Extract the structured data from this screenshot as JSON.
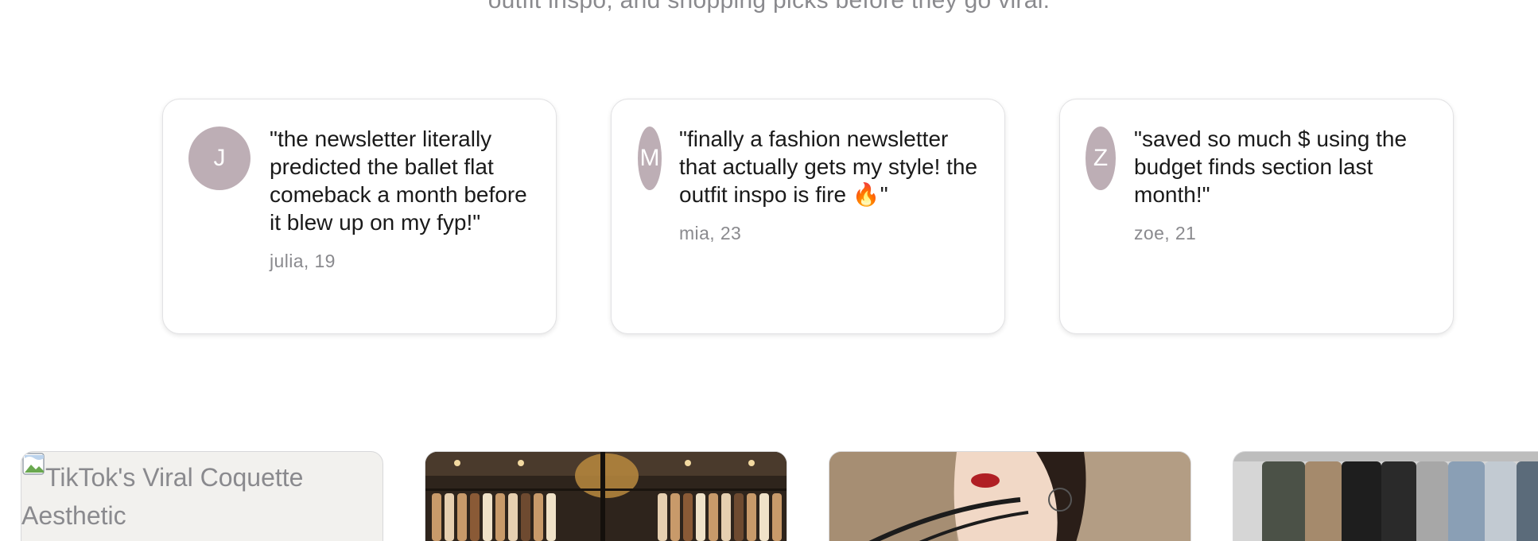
{
  "hero": {
    "subtitle": "outfit inspo, and shopping picks before they go viral."
  },
  "testimonials": [
    {
      "initial": "J",
      "quote": "\"the newsletter literally predicted the ballet flat comeback a month before it blew up on my fyp!\"",
      "author": "julia, 19"
    },
    {
      "initial": "M",
      "quote": "\"finally a fashion newsletter that actually gets my style! the outfit inspo is fire 🔥\"",
      "author": "mia, 23"
    },
    {
      "initial": "Z",
      "quote": "\"saved so much $ using the budget finds section last month!\"",
      "author": "zoe, 21"
    }
  ],
  "gallery": {
    "tile_1_alt": "TikTok's Viral Coquette Aesthetic",
    "tile_1_icon": "broken-image-icon"
  },
  "colors": {
    "avatar_bg": "#bdaeb5",
    "muted_text": "#8a8a8e",
    "card_border": "#e2e2e4"
  }
}
